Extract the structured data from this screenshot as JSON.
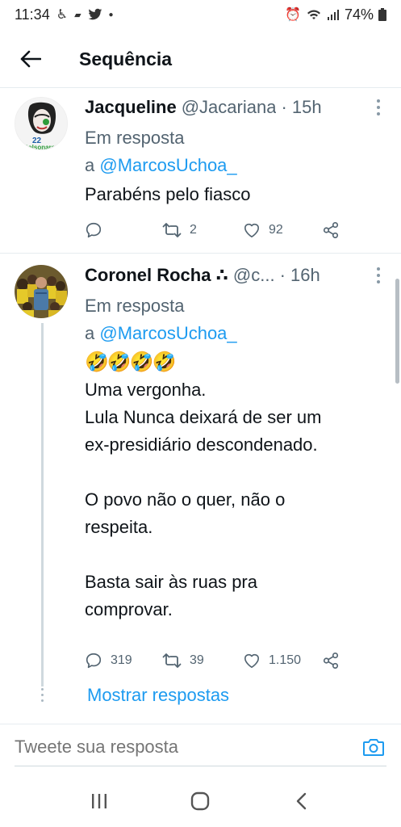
{
  "status_bar": {
    "time": "11:34",
    "battery": "74%"
  },
  "header": {
    "title": "Sequência"
  },
  "tweets": [
    {
      "name": "Jacqueline",
      "handle": "@Jacariana",
      "time": "· 15h",
      "reply_prefix": "Em resposta",
      "reply_to_prefix": "a ",
      "reply_to": "@MarcosUchoa_",
      "text": "Parabéns pelo fiasco",
      "avatar_badge_number": "22",
      "avatar_badge_text": "Bolsonaro",
      "replies": "",
      "retweets": "2",
      "likes": "92"
    },
    {
      "name": "Coronel Rocha ∴",
      "handle": "@c...",
      "time": "· 16h",
      "reply_prefix": "Em resposta",
      "reply_to_prefix": "a ",
      "reply_to": "@MarcosUchoa_",
      "emojis": "🤣🤣🤣🤣",
      "text_lines": [
        "Uma vergonha.",
        "Lula Nunca deixará de ser um",
        "ex-presidiário descondenado.",
        "",
        "O povo não o quer, não o",
        "respeita.",
        "",
        "Basta sair às ruas pra",
        "comprovar."
      ],
      "replies": "319",
      "retweets": "39",
      "likes": "1.150"
    }
  ],
  "show_replies": "Mostrar respostas",
  "reply_bar": {
    "placeholder": "Tweete sua resposta"
  },
  "colors": {
    "accent": "#1d9bf0",
    "secondary_text": "#536471",
    "primary_text": "#0f1419"
  }
}
